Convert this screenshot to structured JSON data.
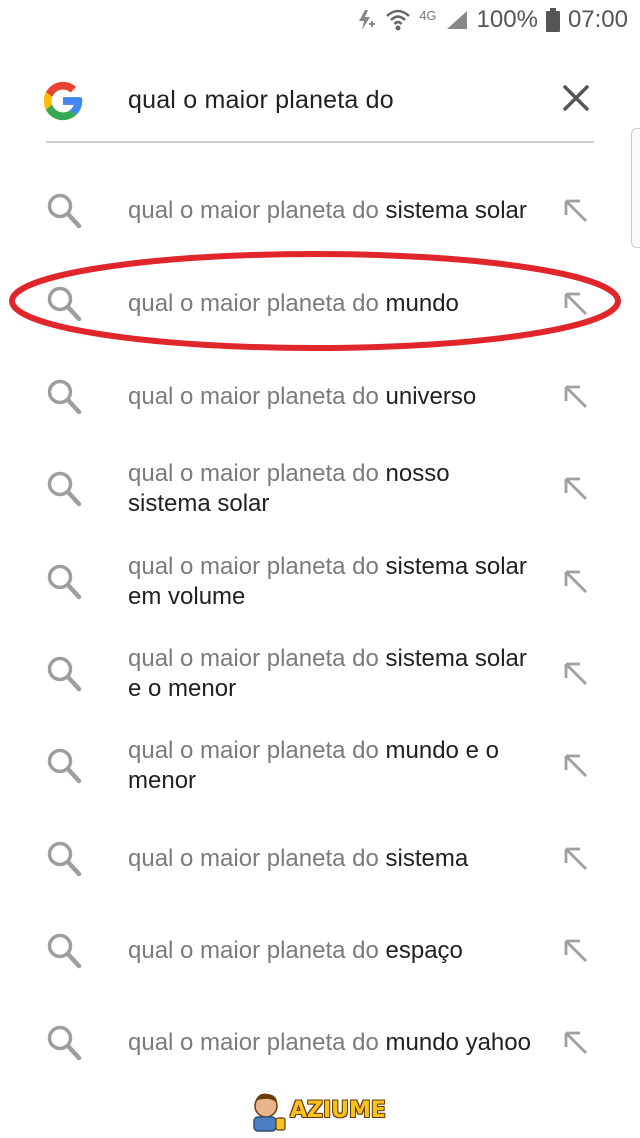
{
  "status_bar": {
    "network": "4G",
    "battery": "100%",
    "time": "07:00"
  },
  "search": {
    "query": "qual o maior planeta do"
  },
  "suggestions": [
    {
      "prefix": "qual o maior planeta do ",
      "suffix": "sistema solar"
    },
    {
      "prefix": "qual o maior planeta do ",
      "suffix": "mundo"
    },
    {
      "prefix": "qual o maior planeta do ",
      "suffix": "universo"
    },
    {
      "prefix": "qual o maior planeta do ",
      "suffix": "nosso sistema solar"
    },
    {
      "prefix": "qual o maior planeta do ",
      "suffix": "sistema solar em volume"
    },
    {
      "prefix": "qual o maior planeta do ",
      "suffix": "sistema solar e o menor"
    },
    {
      "prefix": "qual o maior planeta do ",
      "suffix": "mundo e o menor"
    },
    {
      "prefix": "qual o maior planeta do ",
      "suffix": "sistema"
    },
    {
      "prefix": "qual o maior planeta do ",
      "suffix": "espaço"
    },
    {
      "prefix": "qual o maior planeta do ",
      "suffix": "mundo yahoo"
    }
  ],
  "watermark": {
    "text": "AZIUME"
  },
  "colors": {
    "highlight_ellipse": "#e0262b",
    "google_blue": "#4285F4",
    "google_red": "#EA4335",
    "google_yellow": "#FBBC05",
    "google_green": "#34A853"
  }
}
